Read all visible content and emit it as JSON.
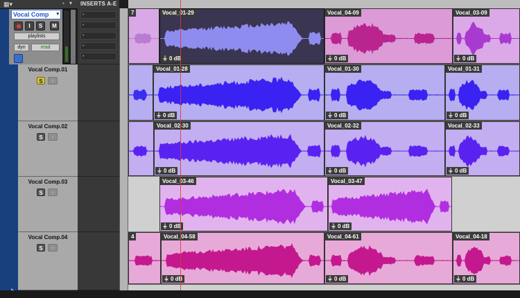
{
  "header": {
    "view_icon": "▦▾",
    "auto_icon": "clock-icon",
    "inserts_label": "INSERTS A-E"
  },
  "tracks": [
    {
      "name": "Vocal Comp",
      "selected": true,
      "controls": {
        "record": "",
        "input": "I",
        "solo": "S",
        "mute": "M",
        "playlists": "playlists",
        "view": "dyn",
        "automation": "read"
      },
      "inserts": [
        "•",
        "•",
        "•",
        "•",
        "•"
      ]
    },
    {
      "name": "Vocal Comp.01",
      "solo": "S",
      "solo_active": true
    },
    {
      "name": "Vocal Comp.02",
      "solo": "S",
      "solo_active": false
    },
    {
      "name": "Vocal Comp.03",
      "solo": "S",
      "solo_active": false
    },
    {
      "name": "Vocal Comp.04",
      "solo": "S",
      "solo_active": false
    }
  ],
  "lanes": [
    {
      "color": "#d8a9e6",
      "clips": [
        {
          "name": "7",
          "gain": "",
          "fill": "#d8a9e6",
          "wave": "#b97cd1"
        },
        {
          "name": "Vocal_01-29",
          "gain": "0 dB",
          "fill": "#3a3550",
          "wave": "#8f8cf0",
          "selected": true
        },
        {
          "name": "Vocal_04-09",
          "gain": "0 dB",
          "fill": "#dc9ad6",
          "wave": "#b9248f"
        },
        {
          "name": "Vocal_03-09",
          "gain": "0 dB",
          "fill": "#dba8e8",
          "wave": "#a93ad0"
        }
      ]
    },
    {
      "color": "#b6aef0",
      "clips": [
        {
          "name": "",
          "gain": "",
          "fill": "#b6aef0",
          "wave": "#3a2ef0"
        },
        {
          "name": "Vocal_01-28",
          "gain": "0 dB",
          "fill": "#b6aef0",
          "wave": "#3a22f2"
        },
        {
          "name": "Vocal_01-30",
          "gain": "0 dB",
          "fill": "#b6aef0",
          "wave": "#3a22f2"
        },
        {
          "name": "Vocal_01-31",
          "gain": "0 dB",
          "fill": "#b6aef0",
          "wave": "#3a22f2"
        }
      ]
    },
    {
      "color": "#c2aef0",
      "clips": [
        {
          "name": "",
          "gain": "",
          "fill": "#c2aef0",
          "wave": "#5a22f0"
        },
        {
          "name": "Vocal_02-30",
          "gain": "0 dB",
          "fill": "#c2aef0",
          "wave": "#5a22f0"
        },
        {
          "name": "Vocal_02-32",
          "gain": "0 dB",
          "fill": "#c2aef0",
          "wave": "#5a22f0"
        },
        {
          "name": "Vocal_02-33",
          "gain": "0 dB",
          "fill": "#c2aef0",
          "wave": "#5a22f0"
        }
      ]
    },
    {
      "color": "#e1b3ee",
      "clips": [
        {
          "name": "Vocal_03-46",
          "gain": "0 dB",
          "fill": "#e1b3ee",
          "wave": "#b12ee0"
        },
        {
          "name": "Vocal_03-47",
          "gain": "0 dB",
          "fill": "#e1b3ee",
          "wave": "#b12ee0"
        }
      ]
    },
    {
      "color": "#e7a9d8",
      "clips": [
        {
          "name": "4",
          "gain": "",
          "fill": "#e7a9d8",
          "wave": "#c4188e"
        },
        {
          "name": "Vocal_04-58",
          "gain": "0 dB",
          "fill": "#e7a9d8",
          "wave": "#c4188e"
        },
        {
          "name": "Vocal_04-61",
          "gain": "0 dB",
          "fill": "#e7a9d8",
          "wave": "#c4188e"
        },
        {
          "name": "Vocal_04-18",
          "gain": "0 dB",
          "fill": "#e7a9d8",
          "wave": "#c4188e"
        }
      ]
    }
  ]
}
